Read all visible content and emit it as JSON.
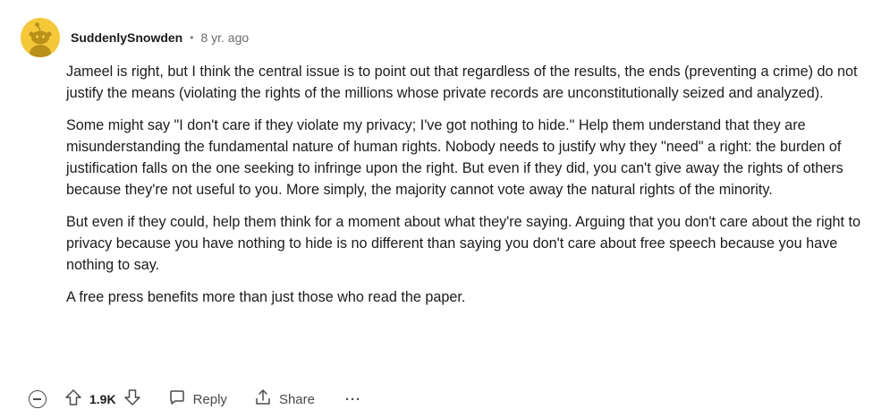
{
  "comment": {
    "author": "SuddenlySnowden",
    "separator": "•",
    "time": "8 yr. ago",
    "paragraphs": [
      "Jameel is right, but I think the central issue is to point out that regardless of the results, the ends (preventing a crime) do not justify the means (violating the rights of the millions whose private records are unconstitutionally seized and analyzed).",
      "Some might say \"I don't care if they violate my privacy; I've got nothing to hide.\" Help them understand that they are misunderstanding the fundamental nature of human rights. Nobody needs to justify why they \"need\" a right: the burden of justification falls on the one seeking to infringe upon the right. But even if they did, you can't give away the rights of others because they're not useful to you. More simply, the majority cannot vote away the natural rights of the minority.",
      "But even if they could, help them think for a moment about what they're saying. Arguing that you don't care about the right to privacy because you have nothing to hide is no different than saying you don't care about free speech because you have nothing to say.",
      "A free press benefits more than just those who read the paper."
    ]
  },
  "actions": {
    "score": "1.9K",
    "reply_label": "Reply",
    "share_label": "Share",
    "more_label": "···"
  },
  "icons": {
    "avatar": "snoo-avatar-icon",
    "collapse": "collapse-icon",
    "upvote": "upvote-icon",
    "downvote": "downvote-icon",
    "reply": "comment-bubble-icon",
    "share": "share-icon",
    "more": "more-icon"
  },
  "colors": {
    "avatar_bg": "#f5c83a",
    "text": "#1c1c1c",
    "muted": "#6b6b6b"
  }
}
